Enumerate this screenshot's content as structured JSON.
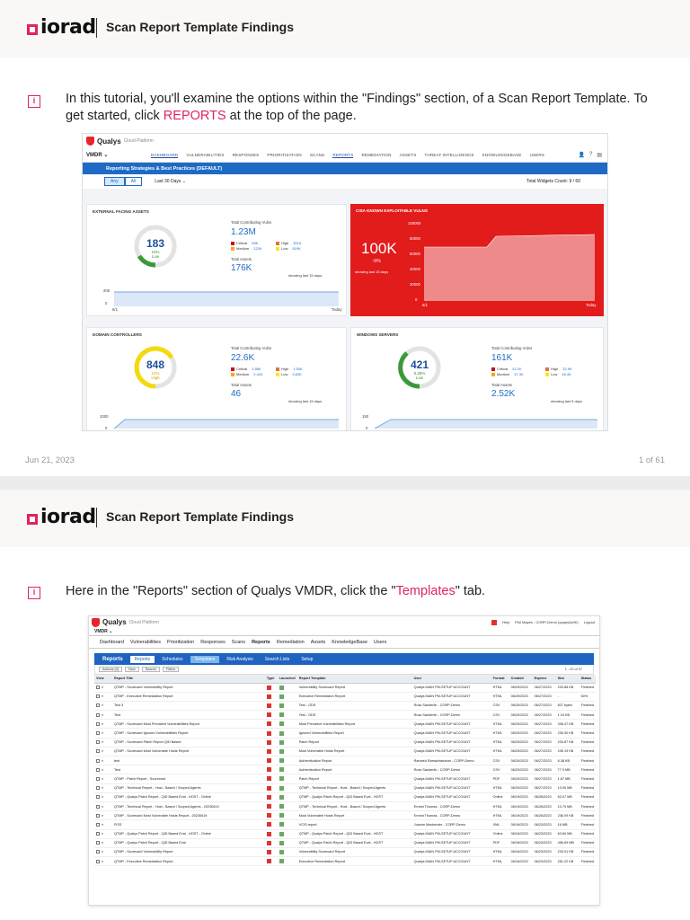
{
  "brand": "iorad",
  "doc_title": "Scan Report Template Findings",
  "page1": {
    "step_text_before": "In this tutorial, you'll examine the options within the \"Findings\" section, of a Scan Report Template. To get started, click ",
    "step_highlight": "REPORTS",
    "step_text_after": " at the top of the page.",
    "footer_date": "Jun 21, 2023",
    "footer_page": "1 of 61",
    "shot": {
      "logo": "Qualys",
      "logo_sub": "Cloud Platform",
      "module": "VMDR",
      "nav": [
        "DASHBOARD",
        "VULNERABILITIES",
        "RESPONSES",
        "PRIORITIZATION",
        "SCANS",
        "REPORTS",
        "REMEDIATION",
        "ASSETS",
        "THREAT INTELLIGENCE",
        "KNOWLEDGEBASE",
        "USERS"
      ],
      "banner": "Reporting Strategies & Best Practices (DEFAULT)",
      "filter_any": "Any",
      "filter_all": "All",
      "filter_range": "Last 30 Days",
      "widget_count": "Total Widgets Count: 9 / 60",
      "w1": {
        "title": "EXTERNAL FACING ASSETS",
        "gauge_value": "183",
        "gauge_pct": "10%",
        "gauge_level": "Low",
        "tcv_label": "Total Contributing Vulns",
        "tcv": "1.23M",
        "sev": [
          {
            "label": "Critical",
            "value": "59K",
            "color": "#d0021b"
          },
          {
            "label": "High",
            "value": "301K",
            "color": "#e8732c"
          },
          {
            "label": "Medium",
            "value": "222K",
            "color": "#f5a623"
          },
          {
            "label": "Low",
            "value": "519K",
            "color": "#f8e71c"
          }
        ],
        "ta_label": "Total Assets",
        "ta": "176K",
        "showing": "showing last 15 days",
        "y_top": "200",
        "y_bot": "0",
        "x_start": "6/1",
        "x_end": "Today"
      },
      "w2": {
        "title": "CISA KNOWN EXPLOITABLE VULNS",
        "value": "100K",
        "delta": "0%",
        "showing": "showing last 15 days",
        "y_ticks": [
          "100000",
          "80000",
          "60000",
          "40000",
          "20000",
          "0"
        ],
        "x_start": "6/1",
        "x_end": "Today"
      },
      "w3": {
        "title": "DOMAIN CONTROLLERS",
        "gauge_value": "848",
        "gauge_pct": "10%",
        "gauge_level": "High",
        "tcv_label": "Total Contributing Vulns",
        "tcv": "22.6K",
        "sev": [
          {
            "label": "Critical",
            "value": "3.58K",
            "color": "#d0021b"
          },
          {
            "label": "High",
            "value": "1.53K",
            "color": "#e8732c"
          },
          {
            "label": "Medium",
            "value": "2.41K",
            "color": "#f5a623"
          },
          {
            "label": "Low",
            "value": "3.63K",
            "color": "#f8e71c"
          }
        ],
        "ta_label": "Total Assets",
        "ta": "46",
        "showing": "showing last 15 days",
        "y_top": "1000",
        "y_bot": "0"
      },
      "w4": {
        "title": "WINDOWS SERVERS",
        "gauge_value": "421",
        "gauge_pct": "0.28%",
        "gauge_level": "Low",
        "tcv_label": "Total Contributing Vulns",
        "tcv": "161K",
        "sev": [
          {
            "label": "Critical",
            "value": "42.1K",
            "color": "#d0021b"
          },
          {
            "label": "High",
            "value": "32.9K",
            "color": "#e8732c"
          },
          {
            "label": "Medium",
            "value": "37.3K",
            "color": "#f5a623"
          },
          {
            "label": "Low",
            "value": "46.4K",
            "color": "#f8e71c"
          }
        ],
        "ta_label": "Total Assets",
        "ta": "2.52K",
        "showing": "showing last 5 days",
        "y_top": "150",
        "y_bot": "0"
      }
    }
  },
  "page2": {
    "step_text_before": "Here in the \"Reports\" section of Qualys VMDR, click the \"",
    "step_highlight": "Templates",
    "step_text_after": "\" tab.",
    "shot": {
      "logo": "Qualys",
      "logo_sub": "Cloud Platform",
      "module": "VMDR",
      "top_right": [
        "Help",
        "Phil Mayes - CORP-Demo (quays2p0K)",
        "Logout"
      ],
      "nav": [
        "Dashboard",
        "Vulnerabilities",
        "Prioritization",
        "Responses",
        "Scans",
        "Reports",
        "Remediation",
        "Assets",
        "KnowledgeBase",
        "Users"
      ],
      "tabs": [
        "Reports",
        "Reports",
        "Schedules",
        "Templates",
        "Risk Analysis",
        "Search Lists",
        "Setup"
      ],
      "toolbar": [
        "Actions (0)",
        "New",
        "Search",
        "Filters"
      ],
      "pager": "1 - 20 of 37",
      "columns": [
        "View",
        "Report Title",
        "Type",
        "Launched",
        "Report Template",
        "User",
        "Format",
        "Created",
        "Expires",
        "Size",
        "Status"
      ],
      "rows": [
        [
          "QTMP - Scorecard Vulnerability Report",
          "Vulnerability Scorecard Report",
          "Qualys MAIN PM-SETUP ACCOUNT",
          "HTML",
          "06/20/2023",
          "06/27/2023",
          "233.88 KB",
          "Finished"
        ],
        [
          "QTMP - Executive Remediation Report",
          "Executive Remediation Report",
          "Qualys MAIN PM-SETUP ACCOUNT",
          "HTML",
          "06/20/2023",
          "06/27/2023",
          "-",
          "60%"
        ],
        [
          "Test 3",
          "Test - GDS",
          "Russ Sanderlin - CORP-Demo",
          "CSV",
          "06/20/2023",
          "06/27/2023",
          "827 bytes",
          "Finished"
        ],
        [
          "Test",
          "Test - GDS",
          "Russ Sanderlin - CORP-Demo",
          "CSV",
          "06/20/2023",
          "06/27/2023",
          "1.15 KB",
          "Finished"
        ],
        [
          "QTMP - Scorecard Most Prevalent Vulnerabilities Report",
          "Most Prevalent Vulnerabilities Report",
          "Qualys MAIN PM-SETUP ACCOUNT",
          "HTML",
          "06/20/2023",
          "06/27/2023",
          "336.47 KB",
          "Finished"
        ],
        [
          "QTMP - Scorecard Ignored Vulnerabilities Report",
          "Ignored Vulnerabilities Report",
          "Qualys MAIN PM-SETUP ACCOUNT",
          "HTML",
          "06/20/2023",
          "06/27/2023",
          "235.30 KB",
          "Finished"
        ],
        [
          "QTMP - Scorecard Patch Report QID Based",
          "Patch Report",
          "Qualys MAIN PM-SETUP ACCOUNT",
          "HTML",
          "06/20/2023",
          "06/27/2023",
          "233.87 KB",
          "Finished"
        ],
        [
          "QTMP - Scorecard Most Vulnerable Hosts Report",
          "Most Vulnerable Hosts Report",
          "Qualys MAIN PM-SETUP ACCOUNT",
          "HTML",
          "06/20/2023",
          "06/27/2023",
          "235.19 KB",
          "Finished"
        ],
        [
          "test",
          "Authentication Report",
          "Ramesh Ramachandran - CORP-Demo",
          "CSV",
          "06/20/2023",
          "06/27/2023",
          "6.38 KB",
          "Finished"
        ],
        [
          "Test",
          "Authentication Report",
          "Russ Sanderlin - CORP-Demo",
          "CSV",
          "06/20/2023",
          "06/27/2023",
          "77.9 MB",
          "Finished"
        ],
        [
          "QTMP - Patch Report - Scorecard",
          "Patch Report",
          "Qualys MAIN PM-SETUP ACCOUNT",
          "PDF",
          "06/20/2023",
          "06/27/2023",
          "1.87 MB",
          "Finished"
        ],
        [
          "QTMP - Technical Report - Host - Based / Scoped Agents",
          "QTMP - Technical Report - Host - Based / Scoped Agents",
          "Qualys MAIN PM-SETUP ACCOUNT",
          "HTML",
          "06/20/2023",
          "06/27/2023",
          "13.99 MB",
          "Finished"
        ],
        [
          "QTMP - Qualys Patch Report - QID Based Eval - HOST - Online",
          "QTMP - Qualys Patch Report - QID Based Eval - HOST",
          "Qualys MAIN PM-SETUP ACCOUNT",
          "Online",
          "06/19/2023",
          "06/26/2023",
          "63.07 MB",
          "Finished"
        ],
        [
          "QTMP - Technical Report - Host - Based / Scoped Agents - 20230619",
          "QTMP - Technical Report - Host - Based / Scoped Agents",
          "Ernest Thomas - CORP-Demo",
          "HTML",
          "06/19/2023",
          "06/26/2023",
          "10.79 MB",
          "Finished"
        ],
        [
          "QTMP - Scorecard Most Vulnerable Hosts Report - 20230619",
          "Most Vulnerable Hosts Report",
          "Ernest Thomas - CORP-Demo",
          "HTML",
          "06/19/2023",
          "06/26/2023",
          "236.09 KB",
          "Finished"
        ],
        [
          "FISS",
          "VCIS report",
          "Joanne Mackenzie - CORP-Demo",
          "XML",
          "06/16/2023",
          "06/23/2023",
          "16 MB",
          "Finished"
        ],
        [
          "QTMP - Qualys Patch Report - QID Based Eval - HOST - Online",
          "QTMP - Qualys Patch Report - QID Based Eval - HOST",
          "Qualys MAIN PM-SETUP ACCOUNT",
          "Online",
          "06/16/2023",
          "06/23/2023",
          "63.69 MB",
          "Finished"
        ],
        [
          "QTMP - Qualys Patch Report - QID Based Eval",
          "QTMP - Qualys Patch Report - QID Based Eval - HOST",
          "Qualys MAIN PM-SETUP ACCOUNT",
          "PDF",
          "06/16/2023",
          "06/23/2023",
          "456.69 MB",
          "Finished"
        ],
        [
          "QTMP - Scorecard Vulnerability Report",
          "Vulnerability Scorecard Report",
          "Qualys MAIN PM-SETUP ACCOUNT",
          "HTML",
          "06/16/2023",
          "06/23/2023",
          "233.91 KB",
          "Finished"
        ],
        [
          "QTMP - Executive Remediation Report",
          "Executive Remediation Report",
          "Qualys MAIN PM-SETUP ACCOUNT",
          "HTML",
          "06/16/2023",
          "06/23/2023",
          "251.22 KB",
          "Finished"
        ]
      ]
    }
  },
  "colors": {
    "brand_pink": "#e0245e",
    "qualys_blue": "#1e6bc6",
    "cisa_red": "#e21b1b"
  }
}
